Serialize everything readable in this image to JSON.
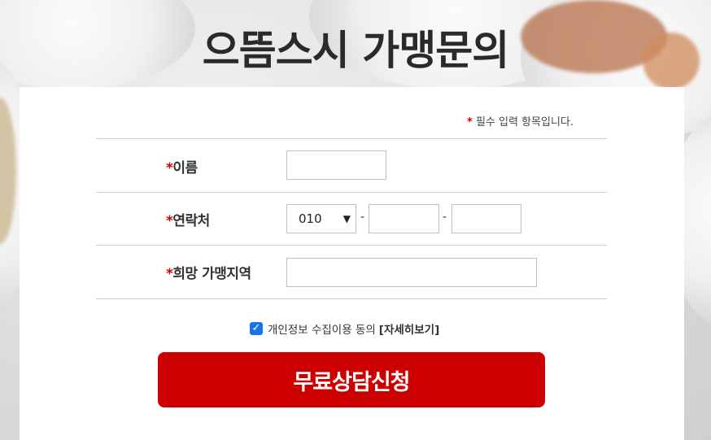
{
  "page": {
    "title": "으뜸스시 가맹문의"
  },
  "form": {
    "required_note": "필수 입력 항목입니다.",
    "required_mark": "*",
    "fields": {
      "name": {
        "label": "이름",
        "value": ""
      },
      "phone": {
        "label": "연락처",
        "prefix_selected": "010",
        "middle": "",
        "last": "",
        "separator": "-"
      },
      "region": {
        "label": "희망 가맹지역",
        "value": ""
      }
    },
    "privacy": {
      "checked": true,
      "text": "개인정보 수집이용 동의",
      "detail_link": "[자세히보기]"
    },
    "submit_label": "무료상담신청"
  },
  "colors": {
    "accent": "#cc0000",
    "required": "#d10000",
    "checkbox": "#1a73e8"
  },
  "icons": {
    "select_arrow": "chevron-down-icon",
    "checkbox": "check-icon"
  }
}
